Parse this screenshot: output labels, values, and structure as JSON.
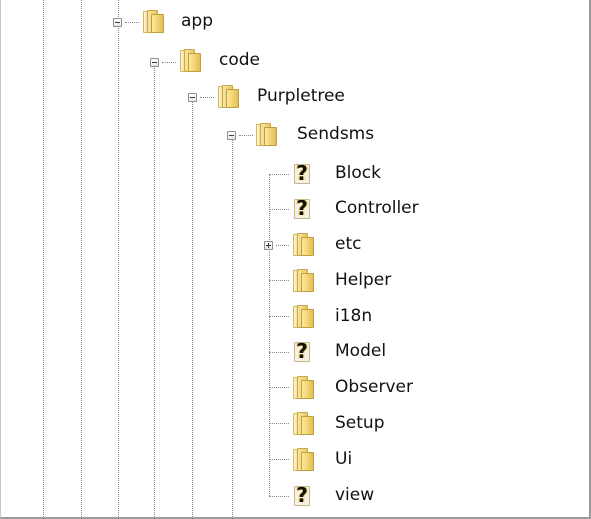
{
  "tree": {
    "nodes": [
      {
        "label": "app",
        "icon": "folder-icon",
        "expander": "expanded"
      },
      {
        "label": "code",
        "icon": "folder-icon",
        "expander": "expanded"
      },
      {
        "label": "Purpletree",
        "icon": "folder-icon",
        "expander": "expanded"
      },
      {
        "label": "Sendsms",
        "icon": "folder-icon",
        "expander": "expanded"
      },
      {
        "label": "Block",
        "icon": "unknown-file-icon",
        "expander": "none"
      },
      {
        "label": "Controller",
        "icon": "unknown-file-icon",
        "expander": "none"
      },
      {
        "label": "etc",
        "icon": "folder-icon",
        "expander": "collapsed"
      },
      {
        "label": "Helper",
        "icon": "folder-icon",
        "expander": "none"
      },
      {
        "label": "i18n",
        "icon": "folder-icon",
        "expander": "none"
      },
      {
        "label": "Model",
        "icon": "unknown-file-icon",
        "expander": "none"
      },
      {
        "label": "Observer",
        "icon": "folder-icon",
        "expander": "none"
      },
      {
        "label": "Setup",
        "icon": "folder-icon",
        "expander": "none"
      },
      {
        "label": "Ui",
        "icon": "folder-icon",
        "expander": "none"
      },
      {
        "label": "view",
        "icon": "unknown-file-icon",
        "expander": "none"
      }
    ]
  }
}
